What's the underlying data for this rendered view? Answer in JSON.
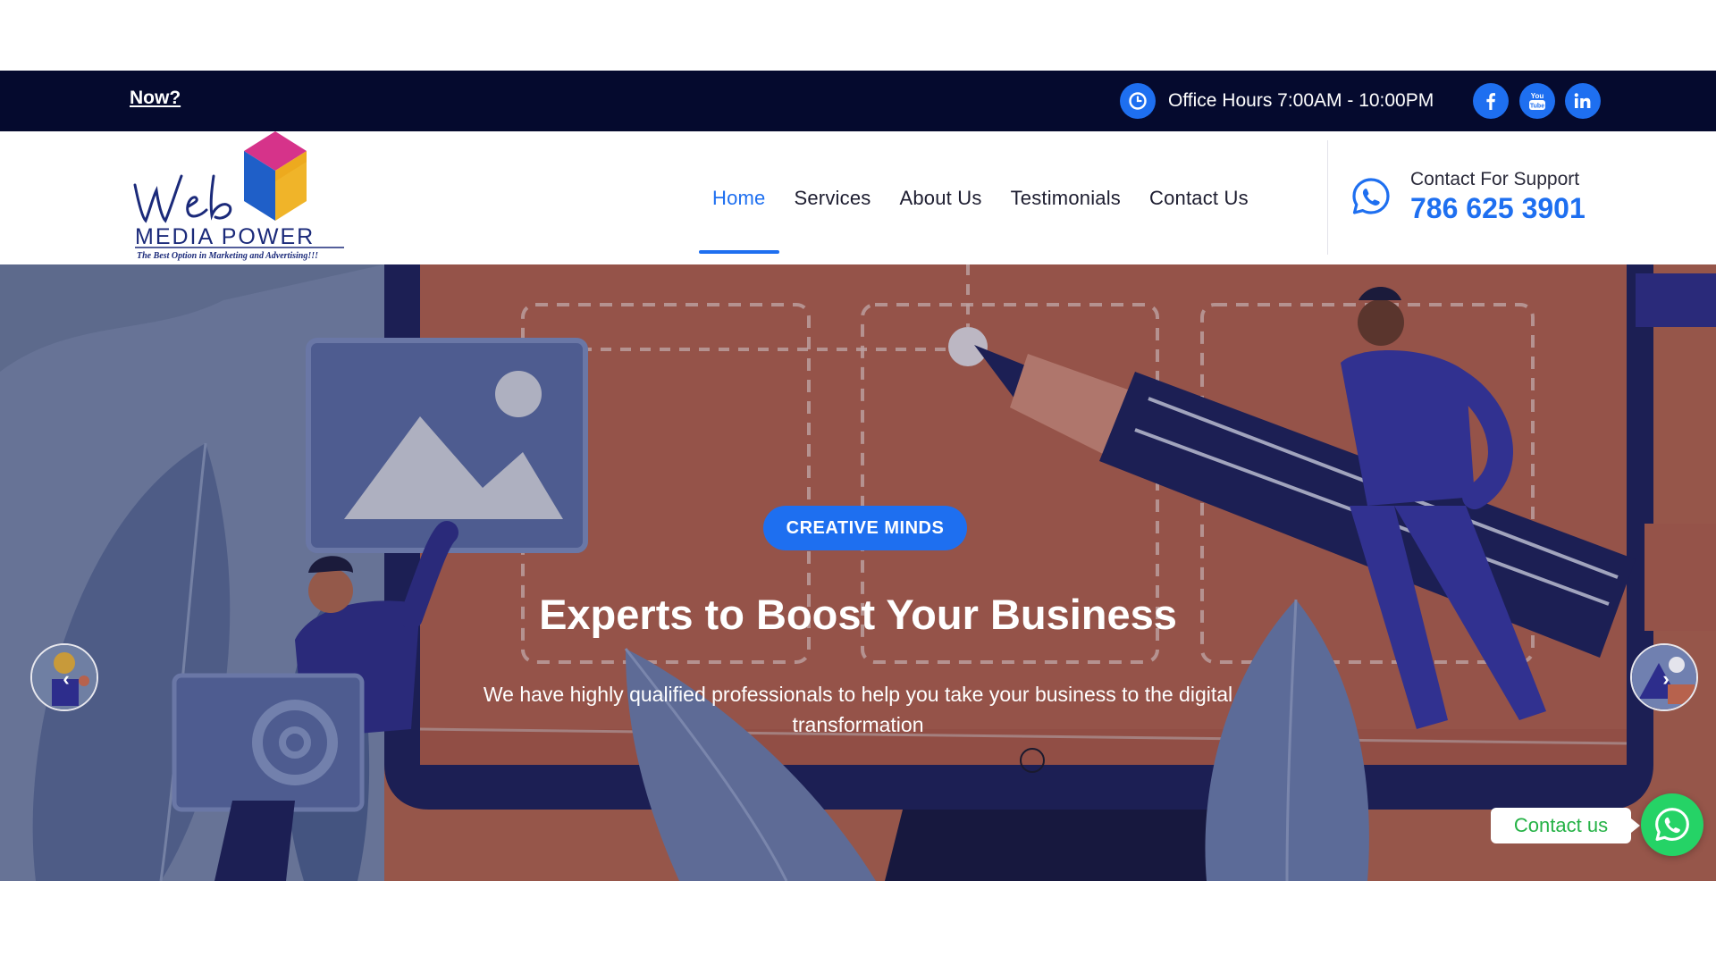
{
  "topbar": {
    "link_label": "Now?",
    "office_hours": "Office Hours 7:00AM - 10:00PM",
    "social": [
      {
        "name": "facebook-icon",
        "glyph": "f"
      },
      {
        "name": "youtube-icon",
        "glyph": "You Tube"
      },
      {
        "name": "linkedin-icon",
        "glyph": "in"
      }
    ]
  },
  "logo": {
    "script_text": "Web",
    "brand_text": "MEDIA POWER",
    "tagline": "The Best Option in Marketing and Advertising!!!"
  },
  "nav": {
    "items": [
      {
        "label": "Home",
        "active": true
      },
      {
        "label": "Services",
        "active": false
      },
      {
        "label": "About Us",
        "active": false
      },
      {
        "label": "Testimonials",
        "active": false
      },
      {
        "label": "Contact Us",
        "active": false
      }
    ]
  },
  "support": {
    "label": "Contact For Support",
    "phone": "786 625 3901"
  },
  "hero": {
    "badge": "CREATIVE MINDS",
    "title": "Experts to Boost Your Business",
    "subtitle": "We have highly qualified professionals to help you take your business to the digital transformation",
    "prev_glyph": "‹",
    "next_glyph": "›"
  },
  "floating": {
    "contact_label": "Contact us"
  },
  "colors": {
    "accent": "#1e6ff0",
    "topbar_bg": "#050a2e",
    "whatsapp": "#25d366"
  }
}
